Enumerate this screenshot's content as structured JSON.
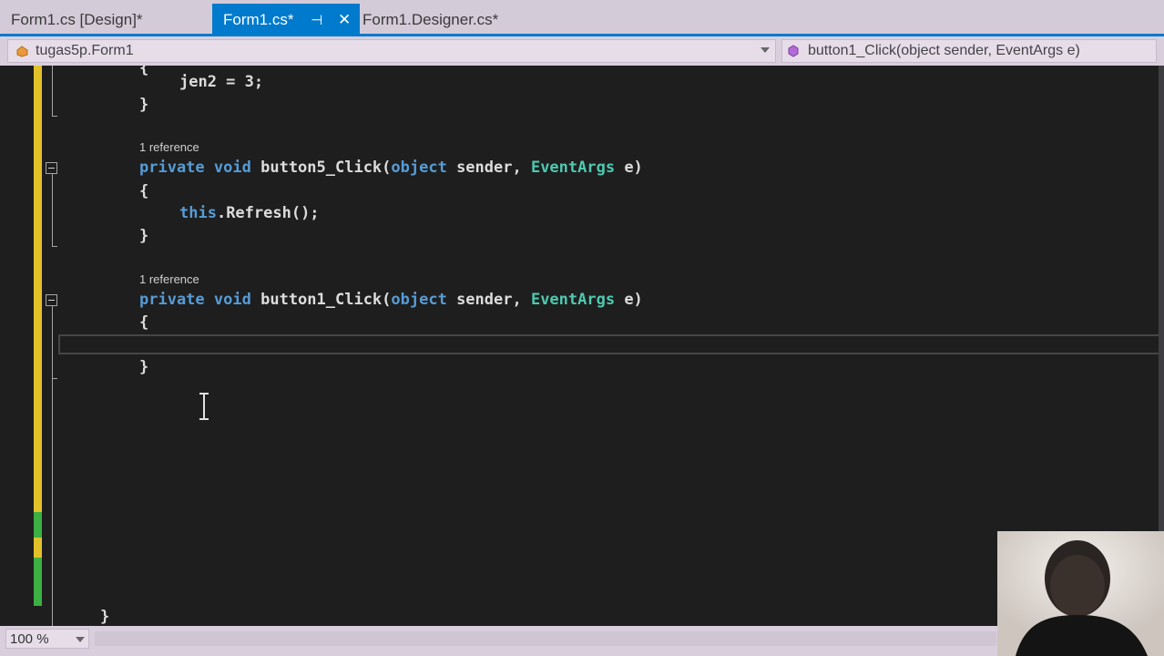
{
  "tabs": [
    {
      "label": "Form1.cs [Design]*",
      "active": false
    },
    {
      "label": "Form1.cs*",
      "active": true,
      "pin": "⊣",
      "close": "✕"
    },
    {
      "label": "Form1.Designer.cs*",
      "active": false
    }
  ],
  "navbar": {
    "class_selector": "tugas5p.Form1",
    "member_selector": "button1_Click(object sender, EventArgs e)"
  },
  "code": {
    "lines": {
      "l1": "{",
      "l2": "jen2 = 3;",
      "l3": "}",
      "lens1": "1 reference",
      "sig1": {
        "k1": "private",
        "k2": "void",
        "name": "button5_Click(",
        "k3": "object",
        "p1": " sender, ",
        "t1": "EventArgs",
        "p2": " e)"
      },
      "l5": "{",
      "l6_kw": "this",
      "l6_rest": ".Refresh();",
      "l7": "}",
      "lens2": "1 reference",
      "sig2": {
        "k1": "private",
        "k2": "void",
        "name": "button1_Click(",
        "k3": "object",
        "p1": " sender, ",
        "t1": "EventArgs",
        "p2": " e)"
      },
      "l9": "{",
      "l10": "}",
      "l11": "}"
    }
  },
  "status": {
    "zoom": "100 %"
  },
  "colors": {
    "accent": "#007acc",
    "keyword": "#569cd6",
    "type": "#4ec9b0",
    "change_unsaved": "#e2c22a",
    "change_saved": "#3cb043"
  }
}
